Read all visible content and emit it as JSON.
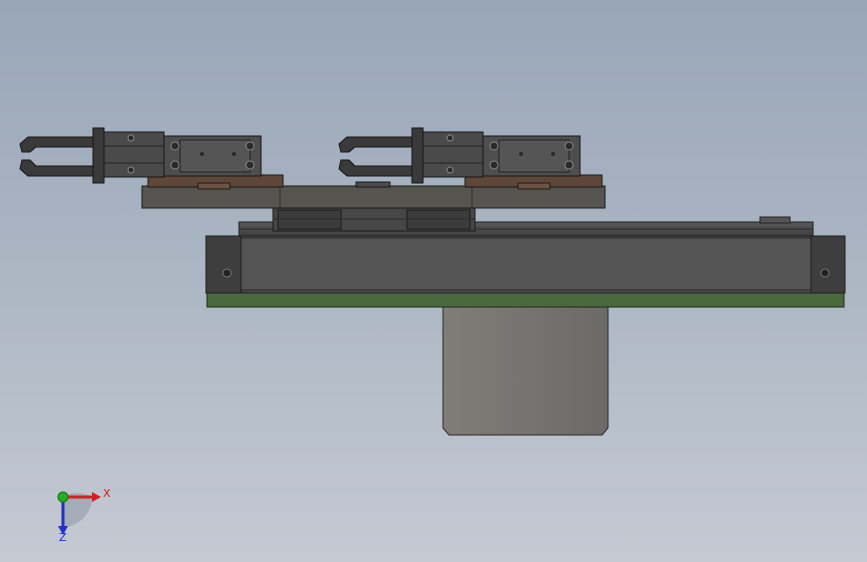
{
  "viewport": {
    "background_top": "#98a6b8",
    "background_bottom": "#c4cad2"
  },
  "model": {
    "body_color": "#4a4a4a",
    "plate_color": "#56544f",
    "base_plate_color": "#4a6a3e",
    "mount_color": "#5e4638",
    "bracket_color": "#777672"
  },
  "triad": {
    "x_label": "X",
    "y_label": "Y",
    "z_label": "Z",
    "x_color": "#d42020",
    "y_color": "#22b022",
    "z_color": "#2030c8"
  }
}
